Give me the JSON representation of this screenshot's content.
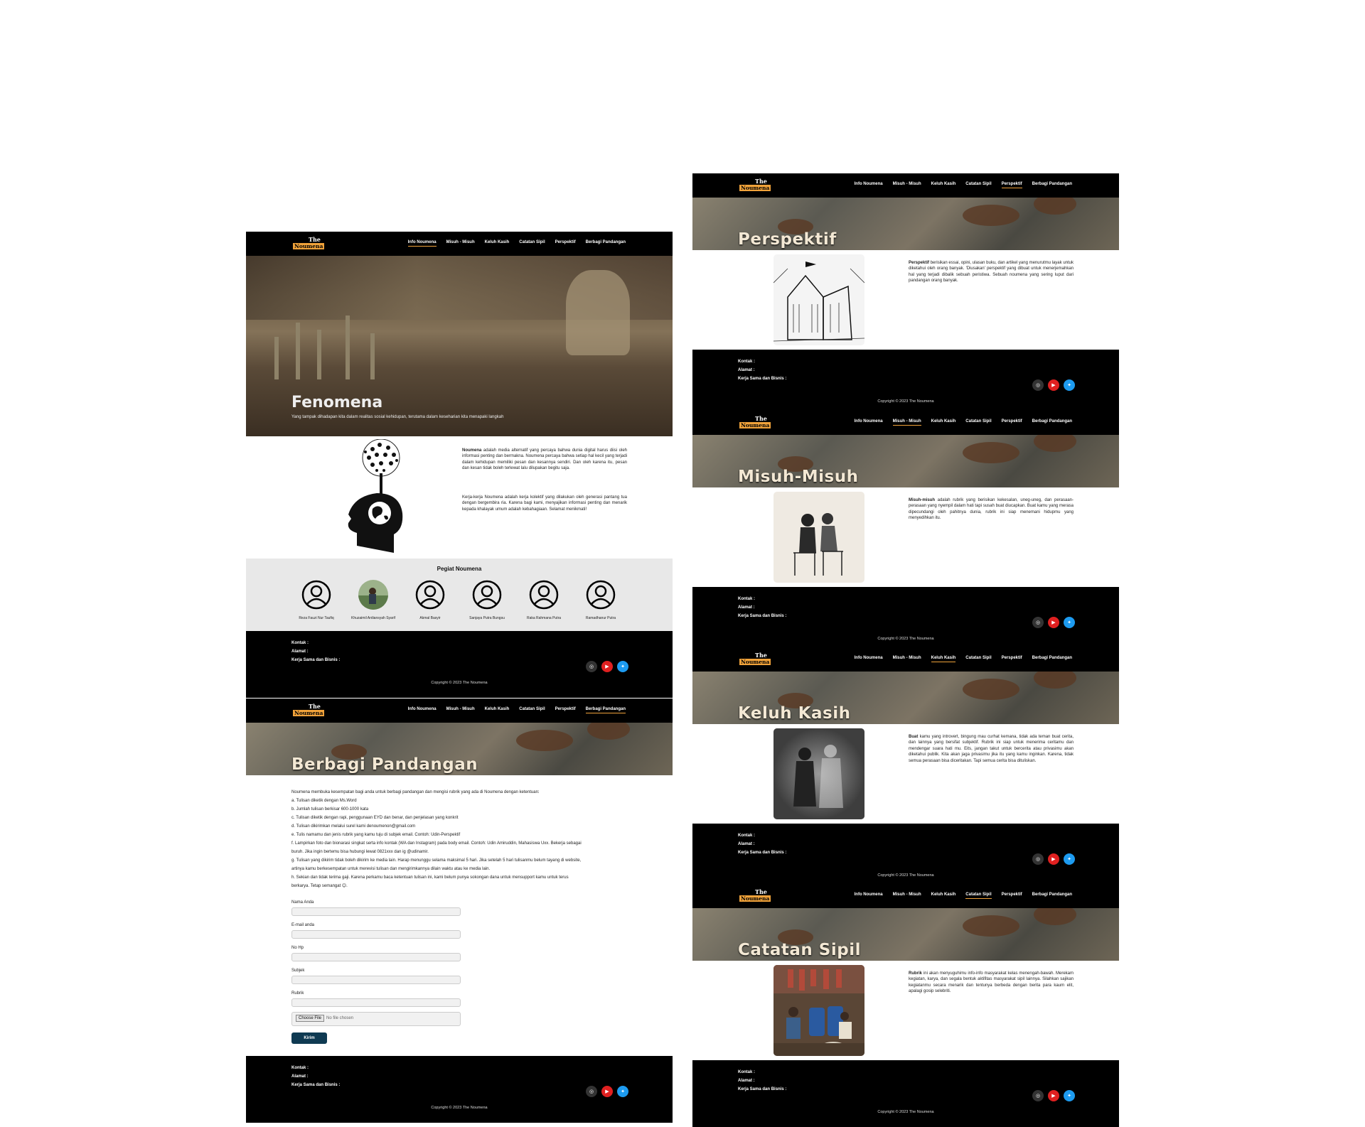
{
  "logo": {
    "the": "The",
    "name": "Noumena"
  },
  "nav": [
    "Info Noumena",
    "Misuh - Misuh",
    "Keluh Kasih",
    "Catatan Sipil",
    "Perspektif",
    "Berbagi Pandangan"
  ],
  "footer": {
    "kontak": "Kontak :",
    "alamat": "Alamat :",
    "kerja": "Kerja Sama dan Bisnis :",
    "copyright": "Copyright © 2023 The Noumena"
  },
  "home": {
    "hero_title": "Fenomena",
    "hero_sub": "Yang tampak dihadapan kita dalam realitas sosial kehidupan, terutama dalam keseharian kita menapaki langkah",
    "intro_bold": "Noumena",
    "intro_p1": " adalah media alternatif yang percaya bahwa dunia digital harus diisi oleh informasi penting dan bermakna. Noumena percaya bahwa setiap hal kecil yang terjadi dalam kehidupan memiliki pesan dan kesannya sendiri. Dan oleh karena itu, pesan dan kesan tidak boleh terlewat lalu dilupakan begitu saja.",
    "intro_p2": "Kerja-kerja Noumena adalah kerja kolektif yang dilakukan oleh generasi pantang tua dengan bergembira ria. Karena bagi kami, menyajikan informasi penting dan menarik kepada khalayak umum adalah kebahagiaan. Selamat menikmati!",
    "team_title": "Pegiat Noumena",
    "members": [
      "Reza Fauzi Nur Taufiq",
      "Khuzaimil Ardiansyah Syarif",
      "Akmal Basyir",
      "Sanjaya Putra Bungsu",
      "Raka Rahmana Putra",
      "Ramadhanur Putra"
    ]
  },
  "berbagi": {
    "title": "Berbagi Pandangan",
    "rules": [
      "Noumena membuka kesempatan bagi anda untuk berbagi pandangan dan mengisi rubrik yang ada di Noumena dengan ketentuan:",
      "a. Tulisan diketik dengan Ms.Word",
      "b. Jumlah tulisan berkisar 600-1000 kata",
      "c. Tulisan diketik dengan rapi, penggunaan EYD dan benar, dan penjelasan yang konkrit",
      "d. Tulisan dikirimkan melalui surel kami denoumenon@gmail.com",
      "e. Tulis namamu dan jenis rubrik yang kamu tuju di subjek email. Contoh: Udin-Perspektif",
      "f. Lampirkan foto dan bionarasi singkat serta info kontak (WA dan Instagram) pada body email. Contoh: Udin Amiruddin, Mahasiswa Uxx. Bekerja sebagai",
      "buruh. Jika ingin bertemu bisa hubungi lewat 0821xxx dan ig @udinamir.",
      "g. Tulisan yang dikirim tidak boleh dikirim ke media lain. Harap menunggu selama maksimal 5 hari. Jika setelah 5 hari tulisanmu belum tayang di website,",
      "artinya kamu berkesempatan untuk merevisi tulisan dan mengirimkannya dilain waktu atau ke media lain.",
      "h. Sekian dan tidak terima gaji. Karena perkamu baca ketentuan tulisan ini, kami belum punya sokongan dana untuk mensupport kamu untuk terus",
      "berkarya. Tetap semangat 😊."
    ],
    "form": {
      "nama": "Nama Anda",
      "email": "E-mail anda",
      "hp": "No Hp",
      "subjek": "Subjek",
      "rubrik": "Rubrik",
      "file_btn": "Choose File",
      "file_none": "No file chosen",
      "submit": "Kirim"
    }
  },
  "perspektif": {
    "title": "Perspektif",
    "bold": "Perspektif",
    "text": " berisikan essai, opini, ulasan buku, dan artikel yang menurutmu layak untuk diketahui oleh orang banyak. 'Diusakan' perspektif yang dibuat untuk menerjemahkan hal yang terjadi dibalik sebuah peristiwa. Sebuah noumena yang sering luput dari pandangan orang banyak."
  },
  "misuh": {
    "title": "Misuh-Misuh",
    "bold": "Misuh-misuh",
    "text": " adalah rubrik yang berisikan kekesalan, uneg-uneg, dan perasaan-perasaan yang nyempil dalam hati tapi susah buat diucapkan. Buat kamu yang merasa dipecundangi oleh pahitnya dunia, rubrik ini siap menemani hidupmu yang menyedihkan itu."
  },
  "keluh": {
    "title": "Keluh Kasih",
    "bold": "Buat",
    "text": " kamu yang introvert, bingung mau curhat kemana, tidak ada teman buat cerita, dan lainnya yang bersifat subjektif. Rubrik ini siap untuk menerima ceritamu dan mendengar suara hati mu. Eits, jangan takut untuk bercerita atau privasimu akan diketahui publik. Kita akan jaga privasimu jika itu yang kamu inginkan. Karena, tidak semua perasaan bisa diceritakan. Tapi semua cerita bisa dituliskan."
  },
  "catatan": {
    "title": "Catatan Sipil",
    "bold": "Rubrik",
    "text": " ini akan menyuguhimu info-info masyarakat kelas menengah-bawah. Merekam kegiatan, karya, dan segala bentuk aktifitas masyarakat sipil lainnya. Silahkan sajikan kegiatanmu secara menarik dan tentunya berbeda dengan berita para kaum elit, apalagi gosip selebriti."
  },
  "colors": {
    "accent": "#f0a23a",
    "button": "#0f3a52",
    "youtube": "#e02020",
    "twitter": "#1d9bf0",
    "instagram": "#333333"
  }
}
